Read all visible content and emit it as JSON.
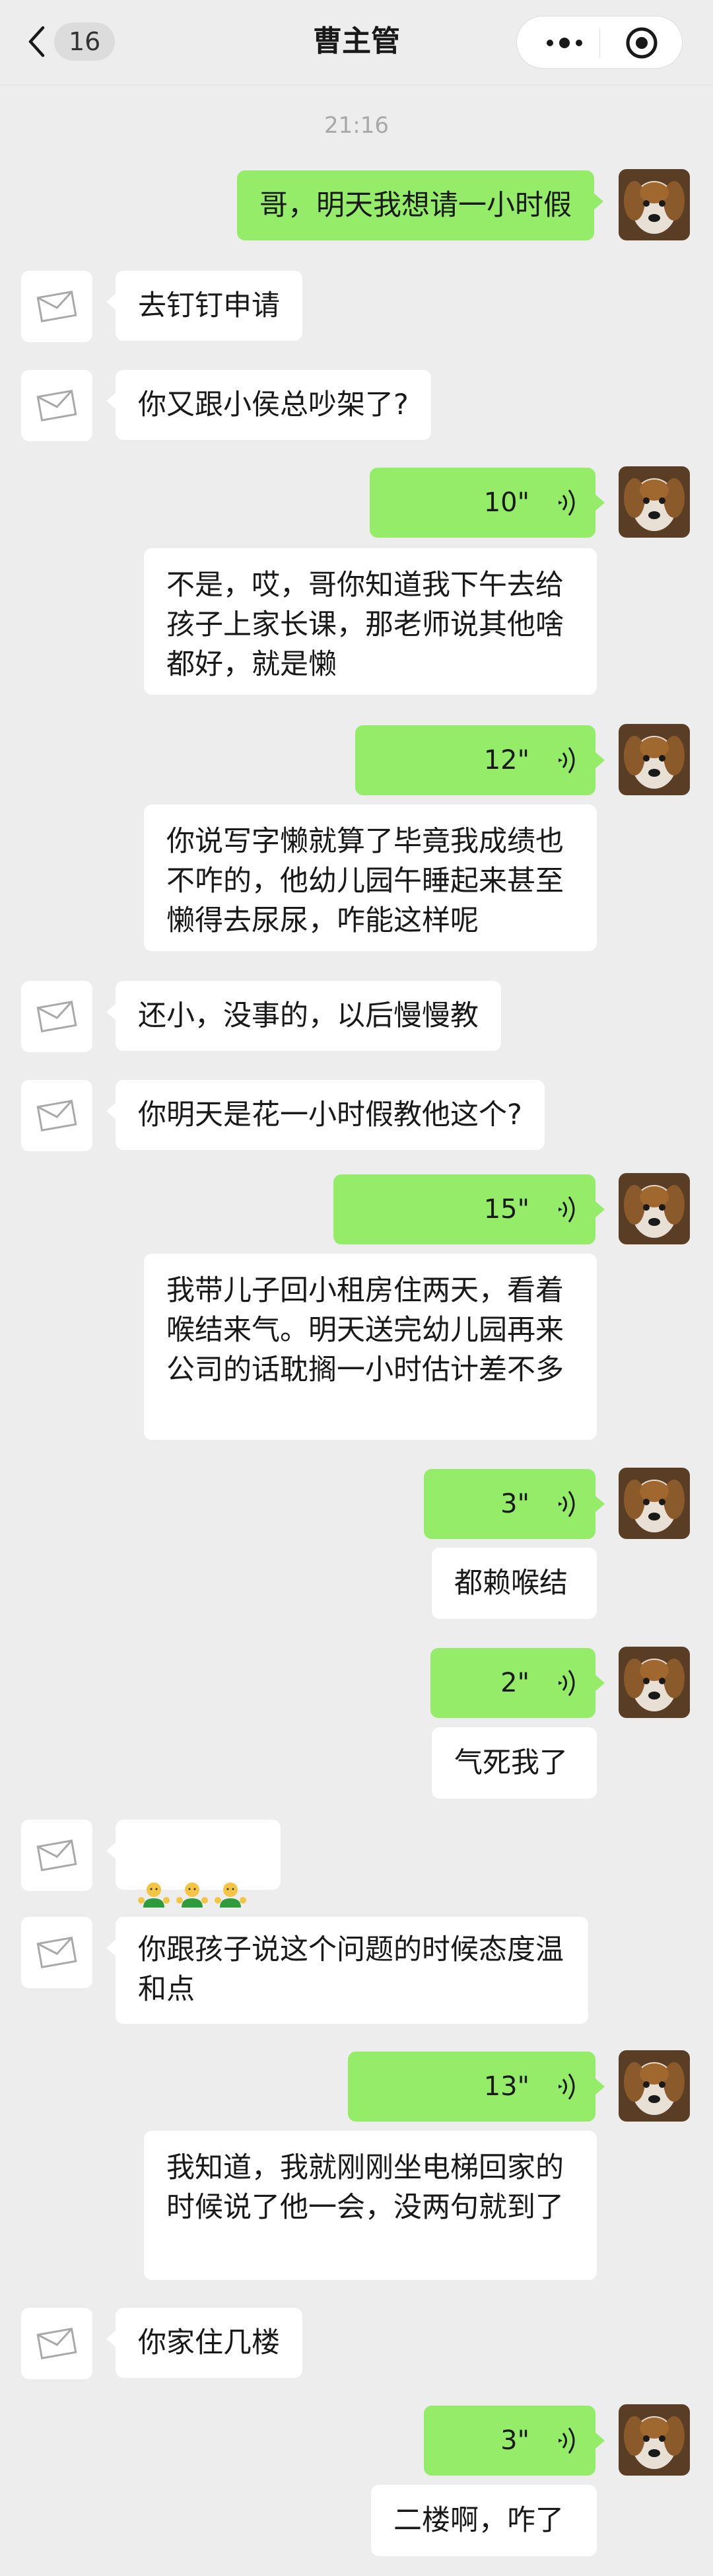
{
  "header": {
    "back_badge": "16",
    "title": "曹主管"
  },
  "chat": {
    "timestamp": "21:16",
    "messages": [
      {
        "side": "me",
        "type": "text",
        "text": "哥，明天我想请一小时假"
      },
      {
        "side": "them",
        "type": "text",
        "text": "去钉钉申请"
      },
      {
        "side": "them",
        "type": "text",
        "text": "你又跟小侯总吵架了?"
      },
      {
        "side": "me",
        "type": "voice",
        "duration": "10\"",
        "transcript": "不是，哎，哥你知道我下午去给孩子上家长课，那老师说其他啥都好，就是懒"
      },
      {
        "side": "me",
        "type": "voice",
        "duration": "12\"",
        "transcript": "你说写字懒就算了毕竟我成绩也不咋的，他幼儿园午睡起来甚至懒得去尿尿，咋能这样呢"
      },
      {
        "side": "them",
        "type": "text",
        "text": "还小，没事的，以后慢慢教"
      },
      {
        "side": "them",
        "type": "text",
        "text": "你明天是花一小时假教他这个?"
      },
      {
        "side": "me",
        "type": "voice",
        "duration": "15\"",
        "transcript": "我带儿子回小租房住两天，看着喉结来气。明天送完幼儿园再来公司的话耽搁一小时估计差不多"
      },
      {
        "side": "me",
        "type": "voice",
        "duration": "3\"",
        "transcript": "都赖喉结"
      },
      {
        "side": "me",
        "type": "voice",
        "duration": "2\"",
        "transcript": "气死我了"
      },
      {
        "side": "them",
        "type": "emoji",
        "emoji_name": "person-shrugging-icon",
        "count": 3
      },
      {
        "side": "them",
        "type": "text",
        "text": "你跟孩子说这个问题的时候态度温和点"
      },
      {
        "side": "me",
        "type": "voice",
        "duration": "13\"",
        "transcript": "我知道，我就刚刚坐电梯回家的时候说了他一会，没两句就到了"
      },
      {
        "side": "them",
        "type": "text",
        "text": "你家住几楼"
      },
      {
        "side": "me",
        "type": "voice",
        "duration": "3\"",
        "transcript": "二楼啊，咋了"
      }
    ]
  },
  "colors": {
    "background": "#ededed",
    "my_bubble": "#95ec69",
    "their_bubble": "#ffffff",
    "timestamp": "#a8a8a8"
  }
}
